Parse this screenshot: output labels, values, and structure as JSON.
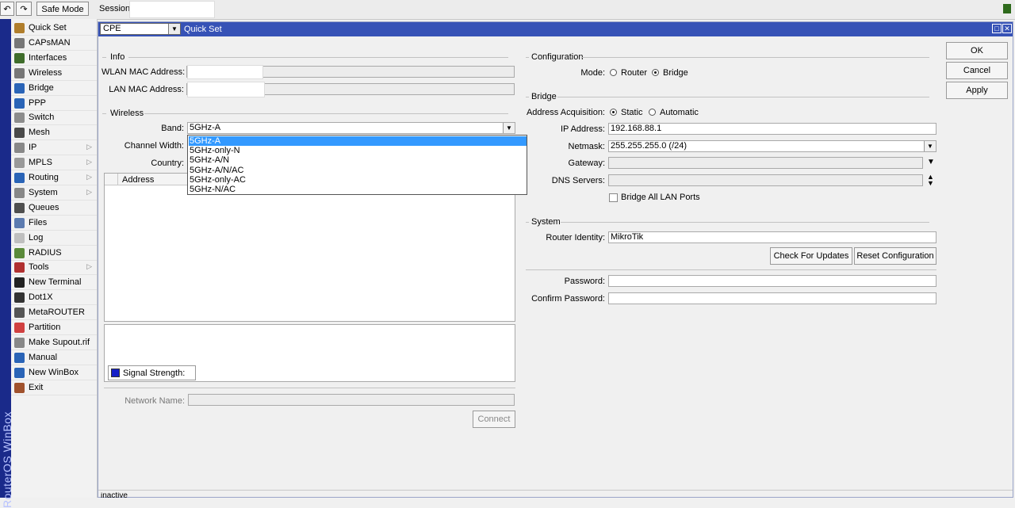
{
  "toolbar": {
    "undo_icon": "undo-icon",
    "redo_icon": "redo-icon",
    "safe_mode": "Safe Mode",
    "session_label": "Session:",
    "status_color": "#2e6a1c"
  },
  "brand": {
    "vertical_text": "RouterOS WinBox",
    "strip_color": "#1a2a8a"
  },
  "menu": [
    {
      "label": "Quick Set",
      "icon": "wand-icon",
      "color": "#b07e2c"
    },
    {
      "label": "CAPsMAN",
      "icon": "antenna-icon",
      "color": "#777777"
    },
    {
      "label": "Interfaces",
      "icon": "ethernet-icon",
      "color": "#3f6d2b"
    },
    {
      "label": "Wireless",
      "icon": "antenna-icon",
      "color": "#777777"
    },
    {
      "label": "Bridge",
      "icon": "bridge-icon",
      "color": "#2a64b7"
    },
    {
      "label": "PPP",
      "icon": "ppp-icon",
      "color": "#2a64b7"
    },
    {
      "label": "Switch",
      "icon": "switch-icon",
      "color": "#8c8c8c"
    },
    {
      "label": "Mesh",
      "icon": "mesh-icon",
      "color": "#4a4a4a"
    },
    {
      "label": "IP",
      "icon": "ip-icon",
      "color": "#888888",
      "sub": true
    },
    {
      "label": "MPLS",
      "icon": "mpls-icon",
      "color": "#999999",
      "sub": true
    },
    {
      "label": "Routing",
      "icon": "routing-icon",
      "color": "#2a64b7",
      "sub": true
    },
    {
      "label": "System",
      "icon": "gear-icon",
      "color": "#888888",
      "sub": true
    },
    {
      "label": "Queues",
      "icon": "queue-icon",
      "color": "#4f4f4f"
    },
    {
      "label": "Files",
      "icon": "folder-icon",
      "color": "#5c7bb0"
    },
    {
      "label": "Log",
      "icon": "log-icon",
      "color": "#bfbfbf"
    },
    {
      "label": "RADIUS",
      "icon": "radius-icon",
      "color": "#5a8a3a"
    },
    {
      "label": "Tools",
      "icon": "tools-icon",
      "color": "#b03030",
      "sub": true
    },
    {
      "label": "New Terminal",
      "icon": "terminal-icon",
      "color": "#222222"
    },
    {
      "label": "Dot1X",
      "icon": "dot1x-icon",
      "color": "#333333"
    },
    {
      "label": "MetaROUTER",
      "icon": "metarouter-icon",
      "color": "#555555"
    },
    {
      "label": "Partition",
      "icon": "partition-icon",
      "color": "#d04040"
    },
    {
      "label": "Make Supout.rif",
      "icon": "file-icon",
      "color": "#888888"
    },
    {
      "label": "Manual",
      "icon": "help-icon",
      "color": "#2a64b7"
    },
    {
      "label": "New WinBox",
      "icon": "globe-icon",
      "color": "#2a64b7"
    },
    {
      "label": "Exit",
      "icon": "exit-icon",
      "color": "#a0522d"
    }
  ],
  "window": {
    "mode_select": "CPE",
    "title": "Quick Set",
    "title_color": "#3652b6"
  },
  "info": {
    "title": "Info",
    "wlan_mac_label": "WLAN MAC Address:",
    "lan_mac_label": "LAN MAC Address:"
  },
  "wireless": {
    "title": "Wireless",
    "band_label": "Band:",
    "band_value": "5GHz-A",
    "channel_width_label": "Channel Width:",
    "country_label": "Country:",
    "address_col": "Address",
    "band_options": [
      "5GHz-A",
      "5GHz-only-N",
      "5GHz-A/N",
      "5GHz-A/N/AC",
      "5GHz-only-AC",
      "5GHz-N/AC"
    ],
    "signal_label": "Signal Strength:",
    "signal_color": "#1520c8",
    "network_name_label": "Network Name:",
    "connect": "Connect"
  },
  "configuration": {
    "title": "Configuration",
    "mode_label": "Mode:",
    "router": "Router",
    "bridge": "Bridge"
  },
  "bridge": {
    "title": "Bridge",
    "acq_label": "Address Acquisition:",
    "static": "Static",
    "automatic": "Automatic",
    "ip_label": "IP Address:",
    "ip_value": "192.168.88.1",
    "netmask_label": "Netmask:",
    "netmask_value": "255.255.255.0 (/24)",
    "gateway_label": "Gateway:",
    "dns_label": "DNS Servers:",
    "bridge_all": "Bridge All LAN Ports"
  },
  "system": {
    "title": "System",
    "identity_label": "Router Identity:",
    "identity_value": "MikroTik",
    "check_updates": "Check For Updates",
    "reset_config": "Reset Configuration",
    "password_label": "Password:",
    "confirm_label": "Confirm Password:"
  },
  "actions": {
    "ok": "OK",
    "cancel": "Cancel",
    "apply": "Apply"
  },
  "status_bar": {
    "text": "inactive"
  }
}
